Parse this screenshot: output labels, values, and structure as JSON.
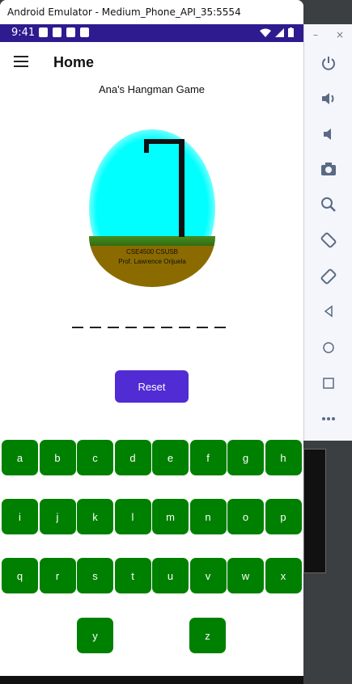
{
  "window": {
    "title": "Android Emulator - Medium_Phone_API_35:5554"
  },
  "status_bar": {
    "time": "9:41"
  },
  "app_bar": {
    "title": "Home"
  },
  "game": {
    "title": "Ana's Hangman Game",
    "credit_line1": "CSE4500 CSUSB",
    "credit_line2": "Prof. Lawrence Orijuela",
    "blank_count": 9,
    "reset_label": "Reset"
  },
  "keyboard": {
    "row1": [
      "a",
      "b",
      "c",
      "d",
      "e",
      "f",
      "g",
      "h"
    ],
    "row2": [
      "i",
      "j",
      "k",
      "l",
      "m",
      "n",
      "o",
      "p"
    ],
    "row3": [
      "q",
      "r",
      "s",
      "t",
      "u",
      "v",
      "w",
      "x"
    ],
    "row4": [
      "y",
      "z"
    ]
  },
  "toolbar": {
    "minimize_label": "–",
    "close_label": "×",
    "items": [
      "power-icon",
      "volume-up-icon",
      "volume-down-icon",
      "camera-icon",
      "zoom-icon",
      "rotate-left-icon",
      "rotate-right-icon",
      "back-icon",
      "home-icon",
      "overview-icon",
      "more-icon"
    ]
  },
  "colors": {
    "key_bg": "#008000",
    "reset_bg": "#512bd4",
    "status_bar_bg": "#2d1b8f",
    "sky": "#00ffff",
    "ground": "#8b6b00"
  }
}
